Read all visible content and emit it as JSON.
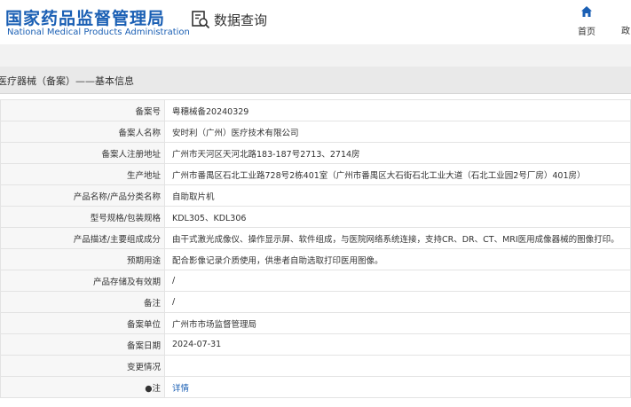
{
  "header": {
    "logo_cn": "国家药品监督管理局",
    "logo_en": "National Medical Products Administration",
    "search_title": "数据查询",
    "nav_home": "首页",
    "nav_gov": "政"
  },
  "breadcrumb": "医疗器械（备案）——基本信息",
  "rows": [
    {
      "label": "备案号",
      "value": "粤穗械备20240329"
    },
    {
      "label": "备案人名称",
      "value": "安时利（广州）医疗技术有限公司"
    },
    {
      "label": "备案人注册地址",
      "value": "广州市天河区天河北路183-187号2713、2714房"
    },
    {
      "label": "生产地址",
      "value": "广州市番禺区石北工业路728号2栋401室（广州市番禺区大石街石北工业大道（石北工业园2号厂房）401房）"
    },
    {
      "label": "产品名称/产品分类名称",
      "value": "自助取片机"
    },
    {
      "label": "型号规格/包装规格",
      "value": "KDL305、KDL306"
    },
    {
      "label": "产品描述/主要组成成分",
      "value": "由干式激光成像仪、操作显示屏、软件组成，与医院网络系统连接，支持CR、DR、CT、MRI医用成像器械的图像打印。"
    },
    {
      "label": "预期用途",
      "value": "配合影像记录介质使用，供患者自助选取打印医用图像。"
    },
    {
      "label": "产品存储及有效期",
      "value": "/"
    },
    {
      "label": "备注",
      "value": "/"
    },
    {
      "label": "备案单位",
      "value": "广州市市场监督管理局"
    },
    {
      "label": "备案日期",
      "value": "2024-07-31"
    },
    {
      "label": "变更情况",
      "value": ""
    },
    {
      "label": "注",
      "value": "详情"
    }
  ],
  "colors": {
    "brand": "#1a5fb4",
    "link": "#1a5fb4"
  }
}
